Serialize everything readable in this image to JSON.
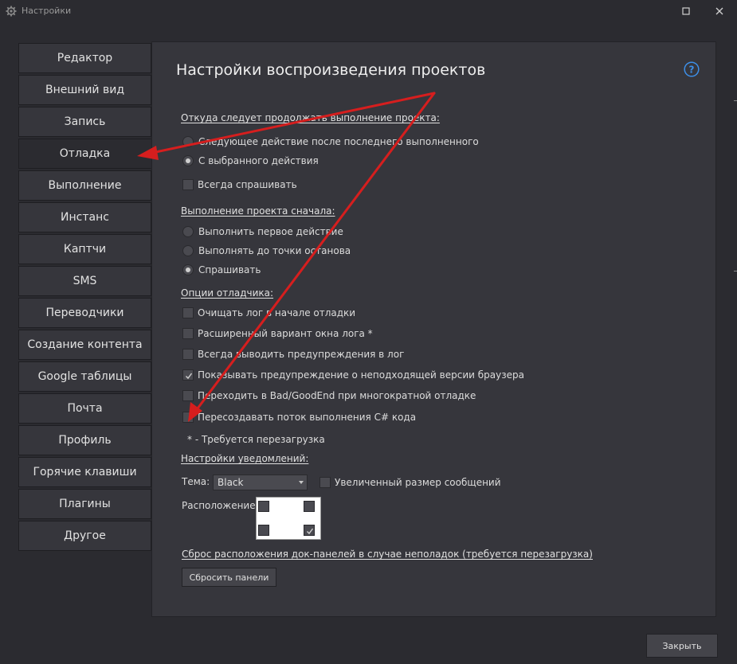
{
  "window": {
    "title": "Настройки"
  },
  "sidebar": {
    "items": [
      {
        "label": "Редактор"
      },
      {
        "label": "Внешний вид"
      },
      {
        "label": "Запись"
      },
      {
        "label": "Отладка",
        "active": true
      },
      {
        "label": "Выполнение"
      },
      {
        "label": "Инстанс"
      },
      {
        "label": "Каптчи"
      },
      {
        "label": "SMS"
      },
      {
        "label": "Переводчики"
      },
      {
        "label": "Создание контента"
      },
      {
        "label": "Google таблицы"
      },
      {
        "label": "Почта"
      },
      {
        "label": "Профиль"
      },
      {
        "label": "Горячие клавиши"
      },
      {
        "label": "Плагины"
      },
      {
        "label": "Другое"
      }
    ]
  },
  "main": {
    "title": "Настройки воспроизведения проектов",
    "continue_section": {
      "title": "Откуда следует продолжать выполнение проекта:",
      "options": [
        {
          "label": "Следующее действие после последнего выполненного",
          "selected": false
        },
        {
          "label": "С выбранного действия",
          "selected": true
        }
      ],
      "always_ask": {
        "label": "Всегда спрашивать",
        "checked": false
      }
    },
    "start_section": {
      "title": "Выполнение проекта сначала:",
      "options": [
        {
          "label": "Выполнить первое действие",
          "selected": false
        },
        {
          "label": "Выполнять до точки останова",
          "selected": false
        },
        {
          "label": "Спрашивать",
          "selected": true
        }
      ]
    },
    "debugger_section": {
      "title": "Опции отладчика:",
      "options": [
        {
          "label": "Очищать лог в начале отладки",
          "checked": false
        },
        {
          "label": "Расширенный вариант окна лога *",
          "checked": false
        },
        {
          "label": "Всегда выводить предупреждения в лог",
          "checked": false
        },
        {
          "label": "Показывать предупреждение о неподходящей версии браузера",
          "checked": true
        },
        {
          "label": "Переходить в Bad/GoodEnd при многократной отладке",
          "checked": false
        },
        {
          "label": "Пересоздавать поток выполнения C# кода",
          "checked": false
        }
      ],
      "note": "* - Требуется перезагрузка"
    },
    "notifications_section": {
      "title": "Настройки уведомлений:",
      "theme_label": "Тема:",
      "theme_value": "Black",
      "bigger_messages": {
        "label": "Увеличенный размер сообщений",
        "checked": false
      },
      "position_label": "Расположение:",
      "position": {
        "top_left": false,
        "top_right": false,
        "bottom_left": false,
        "bottom_right": true
      }
    },
    "reset": {
      "link": "Сброс расположения док-панелей в случае неполадок (требуется перезагрузка)",
      "button": "Сбросить панели"
    }
  },
  "footer": {
    "close_button": "Закрыть"
  },
  "colors": {
    "background": "#2b2b30",
    "panel": "#36363c",
    "annotation_arrow": "#d61e1e",
    "help_accent": "#3d8fe8"
  }
}
